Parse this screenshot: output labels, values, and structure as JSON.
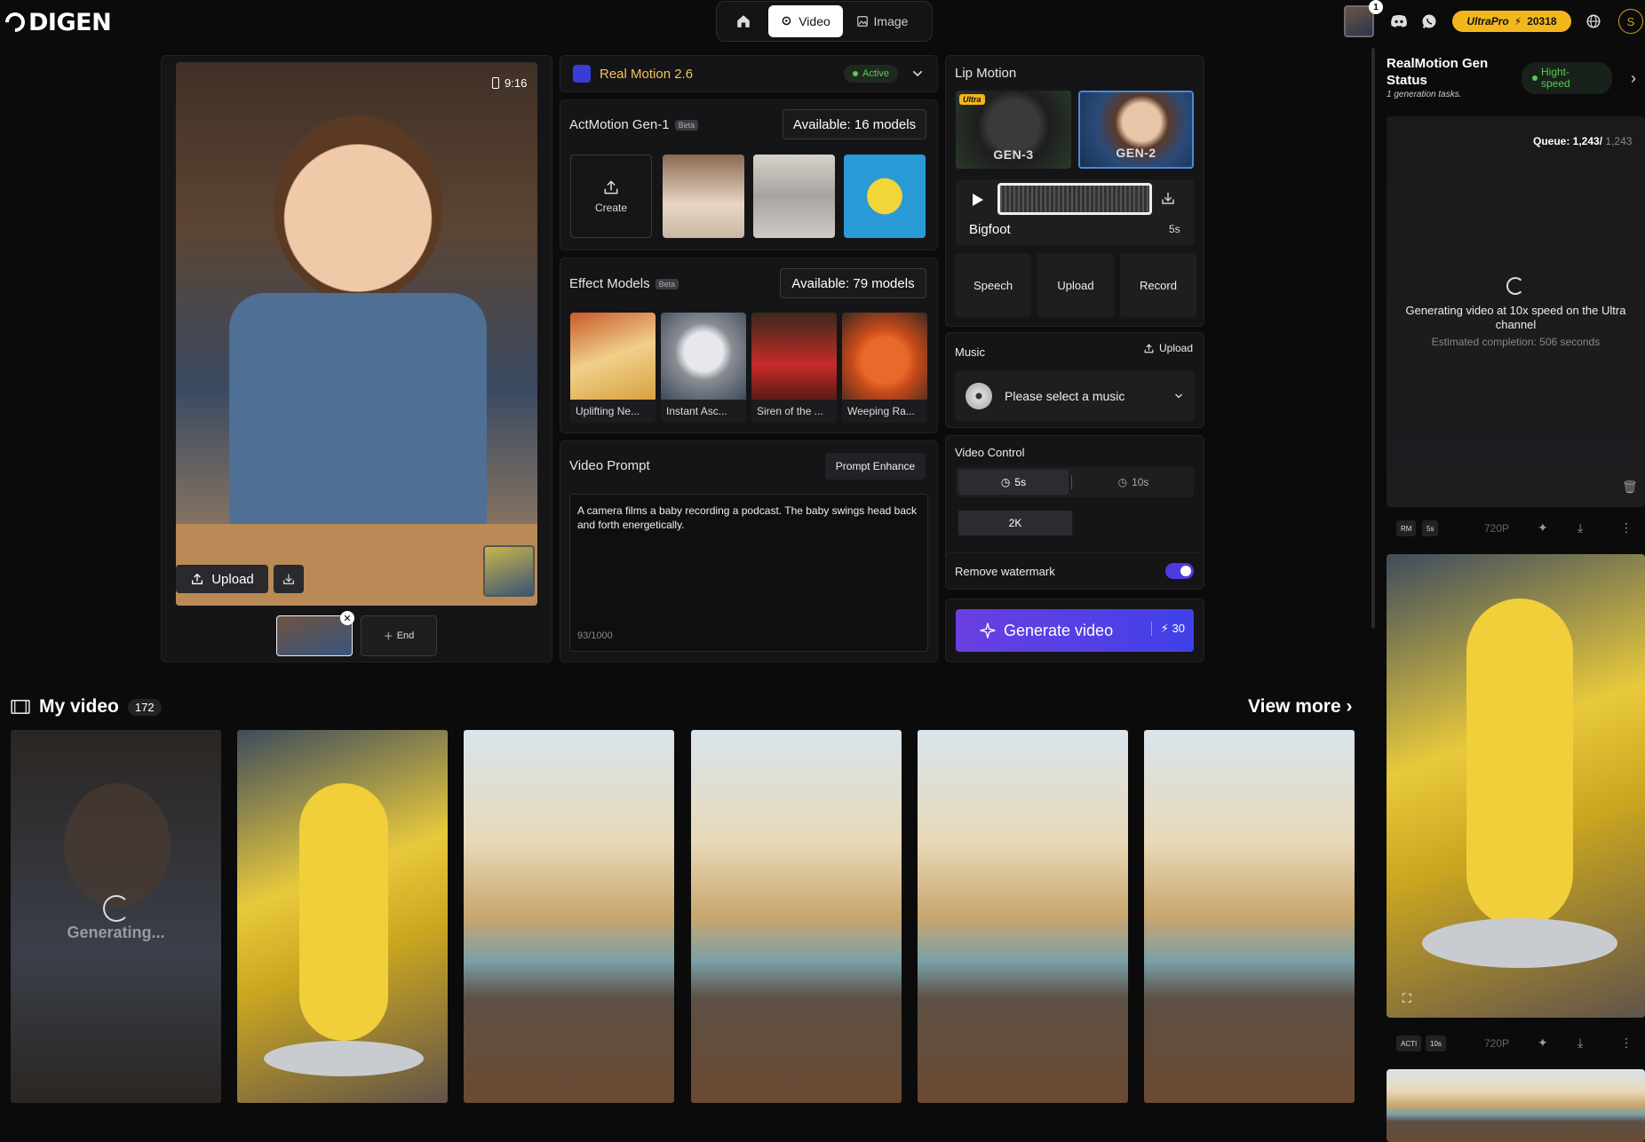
{
  "header": {
    "logo": "DIGEN",
    "nav": [
      {
        "label": "",
        "icon": "home-icon"
      },
      {
        "label": "Video",
        "icon": "video-icon"
      },
      {
        "label": "Image",
        "icon": "image-icon"
      }
    ],
    "notification_count": "1",
    "plan": "UltraPro",
    "credits": "20318",
    "user_initial": "S"
  },
  "preview": {
    "aspect_ratio": "9:16",
    "upload_label": "Upload",
    "end_label": "End"
  },
  "model": {
    "name": "Real Motion 2.6",
    "status": "Active"
  },
  "actmotion": {
    "title": "ActMotion Gen-1",
    "beta": "Beta",
    "available": "Available: 16 models",
    "create_label": "Create"
  },
  "effects": {
    "title": "Effect Models",
    "beta": "Beta",
    "available": "Available: 79 models",
    "items": [
      {
        "label": "Uplifting Ne..."
      },
      {
        "label": "Instant Asc..."
      },
      {
        "label": "Siren of the ..."
      },
      {
        "label": "Weeping Ra..."
      }
    ]
  },
  "prompt": {
    "title": "Video Prompt",
    "enhance_label": "Prompt Enhance",
    "text": "A camera films a baby recording a podcast. The baby swings head back and forth energetically.",
    "count": "93/1000"
  },
  "lip_motion": {
    "title": "Lip Motion",
    "ultra_badge": "Ultra",
    "gens": [
      "GEN-3",
      "GEN-2"
    ],
    "track_name": "Bigfoot",
    "track_duration": "5s",
    "actions": [
      "Speech",
      "Upload",
      "Record"
    ]
  },
  "music": {
    "title": "Music",
    "upload_label": "Upload",
    "placeholder": "Please select a music"
  },
  "video_control": {
    "title": "Video Control",
    "durations": [
      "5s",
      "10s"
    ],
    "selected_duration": "5s",
    "resolution": "2K"
  },
  "watermark": {
    "label": "Remove watermark",
    "enabled": true
  },
  "generate": {
    "label": "Generate video",
    "cost": "30"
  },
  "my_video": {
    "title": "My video",
    "count": "172",
    "view_more": "View more",
    "generating_label": "Generating..."
  },
  "status_panel": {
    "title": "RealMotion Gen Status",
    "subtitle": "1 generation tasks.",
    "speed": "Hight-speed",
    "queue_label": "Queue: 1,243/",
    "queue_total": "1,243",
    "message": "Generating video at 10x speed on the Ultra channel",
    "estimate": "Estimated completion: 506 seconds",
    "tasks": [
      {
        "tag": "RM",
        "duration": "5s",
        "resolution": "720P"
      },
      {
        "tag": "ACTI",
        "duration": "10s",
        "resolution": "720P"
      }
    ]
  },
  "colors": {
    "accent": "#4b3be0",
    "gold": "#f3b71e",
    "green": "#5ac85a"
  }
}
